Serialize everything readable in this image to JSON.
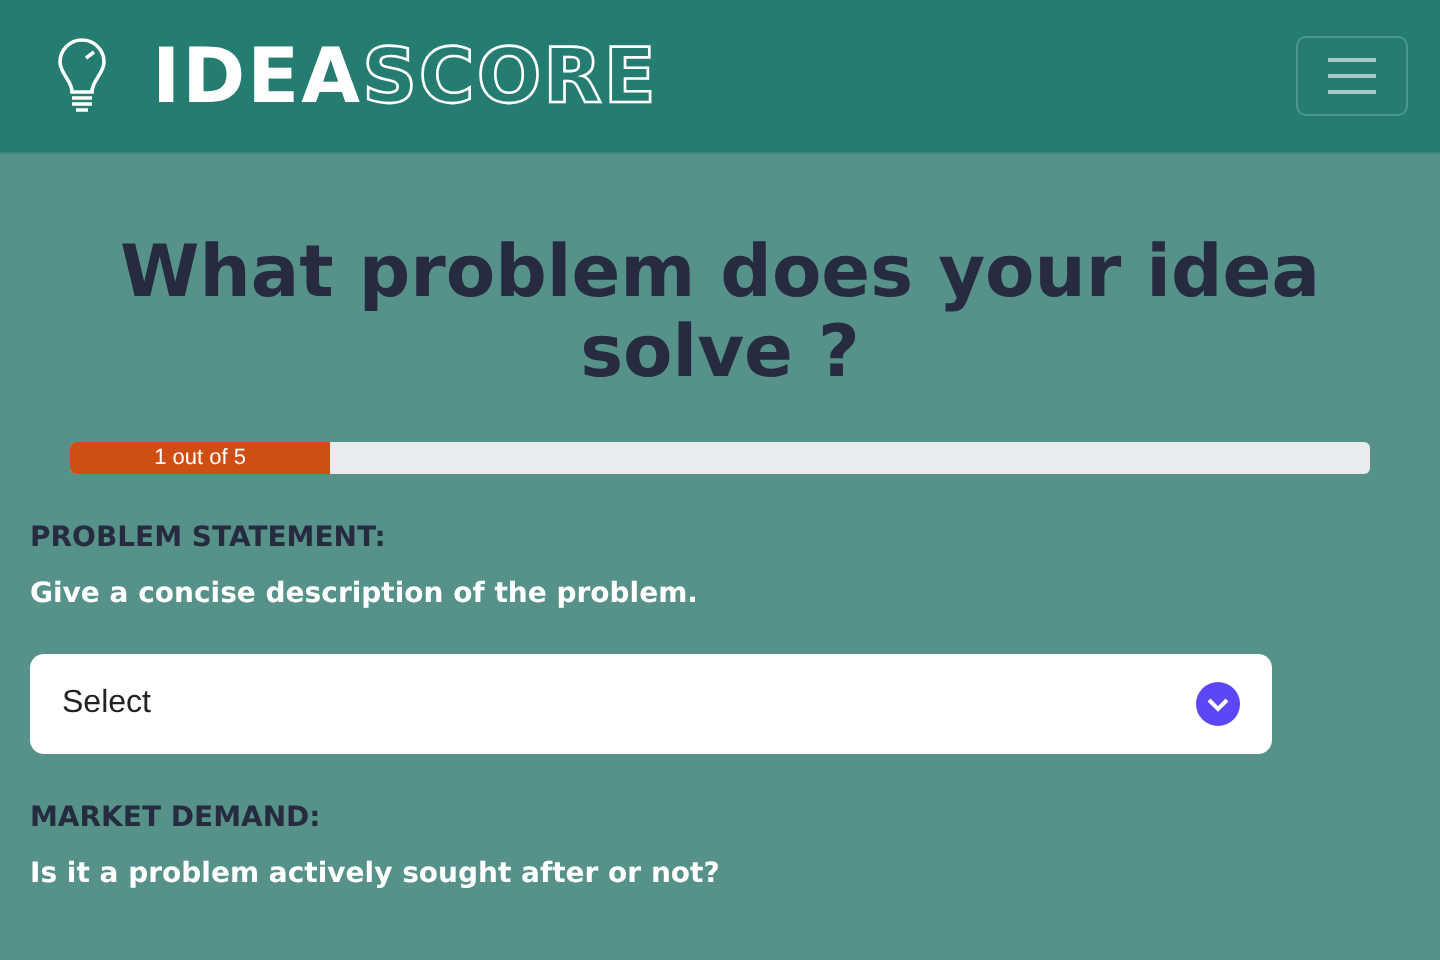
{
  "header": {
    "logo": {
      "solid": "IDEA",
      "outline": "SCORE"
    }
  },
  "title": "What problem does your idea solve ?",
  "progress": {
    "level": 0.2,
    "label": "1 out of 5"
  },
  "questions": [
    {
      "kind": "select",
      "heading": "PROBLEM STATEMENT:",
      "prompt": "Give a concise description of the problem.",
      "value": "Select"
    },
    {
      "kind": "heading",
      "heading": "MARKET DEMAND:",
      "prompt": "Is it a problem actively sought after or not?"
    }
  ]
}
